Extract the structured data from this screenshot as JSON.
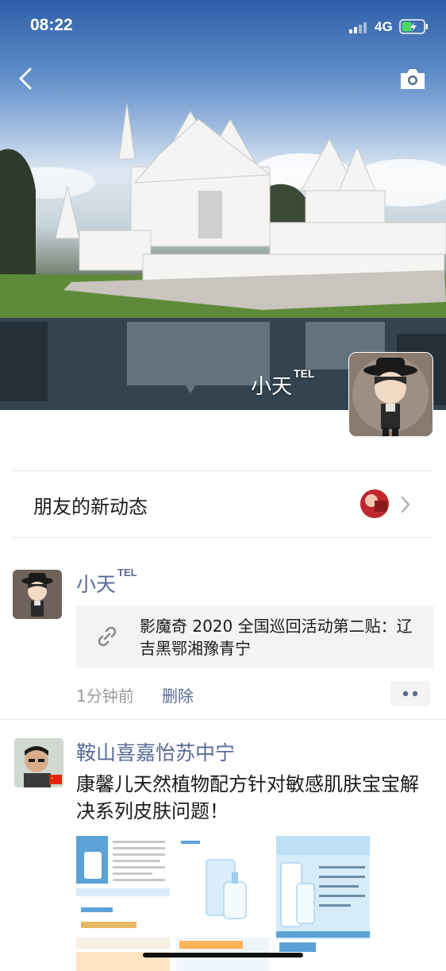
{
  "status_bar": {
    "time": "08:22",
    "network": "4G"
  },
  "cover": {
    "owner_name": "小天",
    "owner_tag": "TEL"
  },
  "icons": {
    "back": "chevron-left-icon",
    "camera": "camera-icon",
    "link": "link-icon",
    "more": "more-dots-icon",
    "chevron": "chevron-right-icon"
  },
  "friends_updates": {
    "label": "朋友的新动态"
  },
  "posts": [
    {
      "author": "小天",
      "author_tag": "TEL",
      "link_title": "影魔奇 2020 全国巡回活动第二贴：辽吉黑鄂湘豫青宁",
      "time_ago": "1分钟前",
      "delete_label": "删除"
    },
    {
      "author": "鞍山喜嘉怡苏中宁",
      "text": "康馨儿天然植物配方针对敏感肌肤宝宝解决系列皮肤问题！"
    }
  ],
  "colors": {
    "name_blue": "#576b95",
    "card_bg": "#f3f3f5",
    "battery_green": "#4cd964"
  }
}
